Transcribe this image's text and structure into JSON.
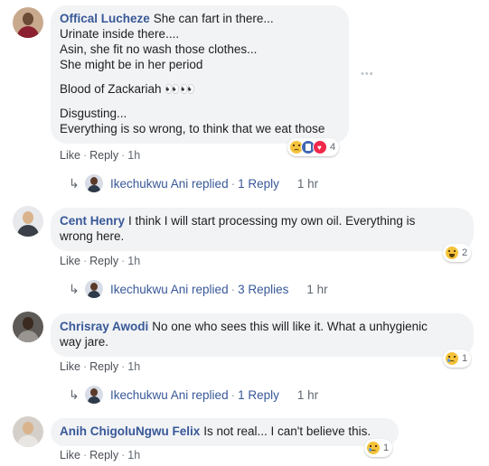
{
  "actions": {
    "like": "Like",
    "reply": "Reply"
  },
  "more_icon": "•••",
  "comments": [
    {
      "author": "Offical Lucheze",
      "lines": [
        "She can fart in there...",
        "Urinate inside there....",
        "Asin, she fit no wash those clothes...",
        "She might be in her period"
      ],
      "lines2": [
        "Blood of Zackariah 👀👀"
      ],
      "lines3": [
        "Disgusting...",
        "Everything is so wrong, to think that we eat those"
      ],
      "time": "1h",
      "reaction_icons": [
        "sad",
        "like",
        "love"
      ],
      "reaction_count": "4",
      "reply": {
        "name": "Ikechukwu Ani replied",
        "count": "1 Reply",
        "time": "1 hr"
      }
    },
    {
      "author": "Cent Henry",
      "lines": [
        "I think I will start processing my own oil. Everything is",
        "wrong here."
      ],
      "time": "1h",
      "reaction_icons": [
        "laugh"
      ],
      "reaction_count": "2",
      "reply": {
        "name": "Ikechukwu Ani replied",
        "count": "3 Replies",
        "time": "1 hr"
      }
    },
    {
      "author": "Chrisray Awodi",
      "lines": [
        "No one who sees this will like it. What a unhygienic",
        "way jare."
      ],
      "time": "1h",
      "reaction_icons": [
        "sad"
      ],
      "reaction_count": "1",
      "reply": {
        "name": "Ikechukwu Ani replied",
        "count": "1 Reply",
        "time": "1 hr"
      }
    },
    {
      "author": "Anih ChigoluNgwu Felix",
      "lines": [
        "Is not real... I can't believe this."
      ],
      "time": "1h",
      "reaction_icons": [
        "sad"
      ],
      "reaction_count": "1"
    }
  ]
}
